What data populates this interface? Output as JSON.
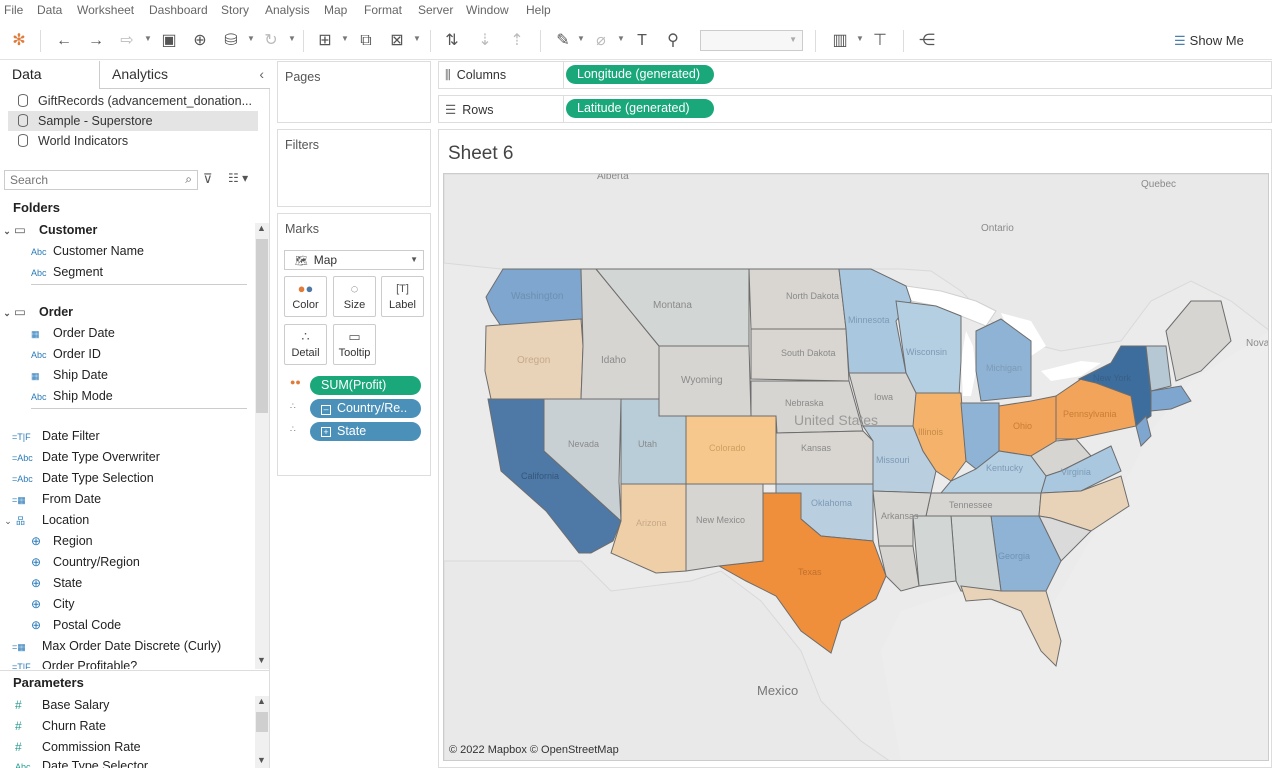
{
  "menu": [
    "File",
    "Data",
    "Worksheet",
    "Dashboard",
    "Story",
    "Analysis",
    "Map",
    "Format",
    "Server",
    "Window",
    "Help"
  ],
  "toolbar": {
    "show_me": "Show Me"
  },
  "left_pane": {
    "tab_data": "Data",
    "tab_analytics": "Analytics",
    "datasources": [
      "GiftRecords (advancement_donation...",
      "Sample - Superstore",
      "World Indicators"
    ],
    "search_placeholder": "Search",
    "folders_heading": "Folders",
    "folder_customer": "Customer",
    "customer_fields": [
      "Customer Name",
      "Segment"
    ],
    "folder_order": "Order",
    "order_fields": [
      "Order Date",
      "Order ID",
      "Ship Date",
      "Ship Mode"
    ],
    "loose_fields": [
      "Date Filter",
      "Date Type Overwriter",
      "Date Type Selection",
      "From Date"
    ],
    "folder_location": "Location",
    "location_fields": [
      "Region",
      "Country/Region",
      "State",
      "City",
      "Postal Code"
    ],
    "after_location": [
      "Max Order Date Discrete (Curly)",
      "Order Profitable?"
    ],
    "parameters_heading": "Parameters",
    "parameters": [
      "Base Salary",
      "Churn Rate",
      "Commission Rate",
      "Date Type Selector"
    ]
  },
  "cards": {
    "pages": "Pages",
    "filters": "Filters",
    "marks": "Marks",
    "mark_type": "Map",
    "mark_buttons": [
      "Color",
      "Size",
      "Label",
      "Detail",
      "Tooltip"
    ],
    "mark_pills": [
      "SUM(Profit)",
      "Country/Re..",
      "State"
    ]
  },
  "shelves": {
    "columns_label": "Columns",
    "columns_pill": "Longitude (generated)",
    "rows_label": "Rows",
    "rows_pill": "Latitude (generated)"
  },
  "sheet_title": "Sheet 6",
  "map": {
    "labels": [
      "Alberta",
      "Quebec",
      "Ontario",
      "Nova",
      "Washington",
      "Montana",
      "North Dakota",
      "Minnesota",
      "Wisconsin",
      "Michigan",
      "South Dakota",
      "Oregon",
      "Idaho",
      "Wyoming",
      "Iowa",
      "New York",
      "Nebraska",
      "United States",
      "Illinois",
      "Ohio",
      "Pennsylvania",
      "Nevada",
      "Utah",
      "Colorado",
      "Kansas",
      "Missouri",
      "Kentucky",
      "Virginia",
      "California",
      "Arizona",
      "New Mexico",
      "Oklahoma",
      "Arkansas",
      "Tennessee",
      "Texas",
      "Georgia",
      "Mexico"
    ],
    "attribution": "© 2022 Mapbox © OpenStreetMap",
    "colors": {
      "max_profit": "#4e79a7",
      "mid_profit": "#7ea6cf",
      "low_profit": "#b7cfe0",
      "neutral": "#d7d5d1",
      "small_loss": "#e8cfae",
      "loss": "#f2a45a",
      "max_loss": "#ef8f3c"
    }
  }
}
